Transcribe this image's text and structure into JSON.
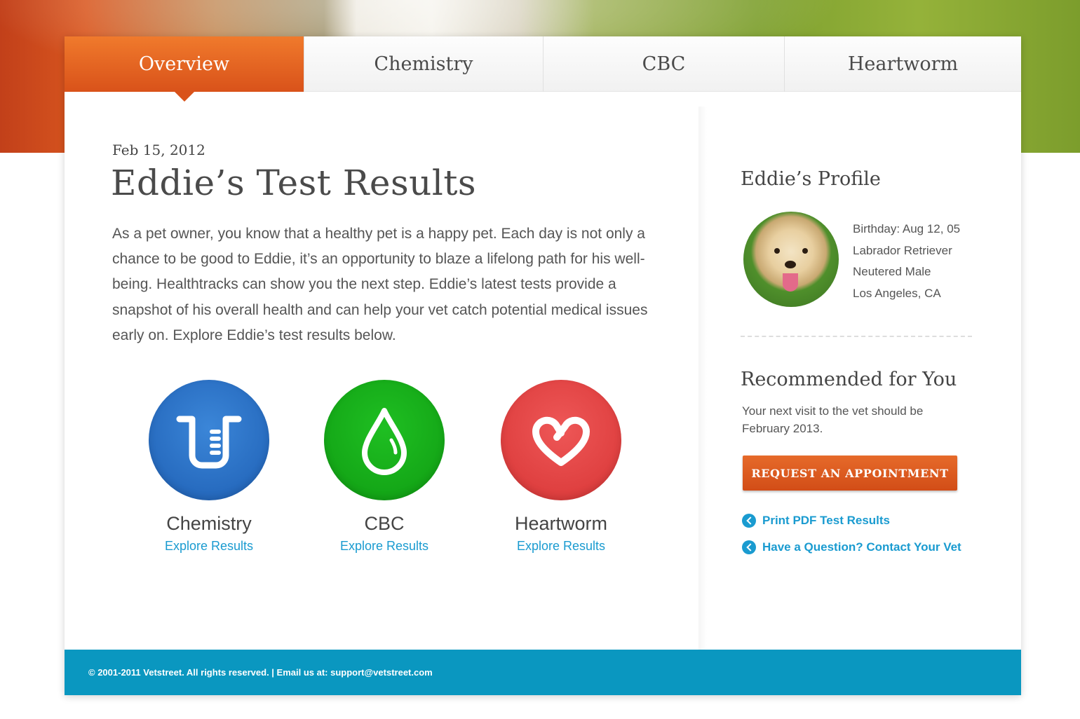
{
  "tabs": [
    {
      "label": "Overview",
      "active": true
    },
    {
      "label": "Chemistry",
      "active": false
    },
    {
      "label": "CBC",
      "active": false
    },
    {
      "label": "Heartworm",
      "active": false
    }
  ],
  "main": {
    "date": "Feb 15, 2012",
    "title": "Eddie’s Test Results",
    "intro": "As a pet owner, you know that a healthy pet is a happy pet. Each day is not only a chance to be good to Eddie, it’s an opportunity to blaze a lifelong path for his well-being. Healthtracks can show you the next step. Eddie’s latest tests provide a snapshot of his overall health and can help your vet catch potential medical issues early on. Explore Eddie’s test results below.",
    "results": [
      {
        "name": "Chemistry",
        "link": "Explore Results",
        "icon": "beaker-icon",
        "color": "#2c72c8"
      },
      {
        "name": "CBC",
        "link": "Explore Results",
        "icon": "drop-icon",
        "color": "#14ad17"
      },
      {
        "name": "Heartworm",
        "link": "Explore Results",
        "icon": "heart-icon",
        "color": "#e24545"
      }
    ]
  },
  "sidebar": {
    "profile_title": "Eddie’s Profile",
    "profile": [
      "Birthday: Aug 12, 05",
      "Labrador Retriever",
      "Neutered Male",
      "Los Angeles, CA"
    ],
    "recommended_title": "Recommended for You",
    "recommended_text": "Your next visit to the vet should be February 2013.",
    "button_label": "REQUEST AN APPOINTMENT",
    "links": [
      "Print PDF Test Results",
      "Have a Question? Contact Your Vet"
    ]
  },
  "footer": {
    "text": "© 2001-2011  Vetstreet. All rights reserved. | Email us at: support@vetstreet.com"
  },
  "colors": {
    "accent_orange": "#e0601f",
    "link_blue": "#1a9bd0",
    "footer_blue": "#0a97c0"
  }
}
